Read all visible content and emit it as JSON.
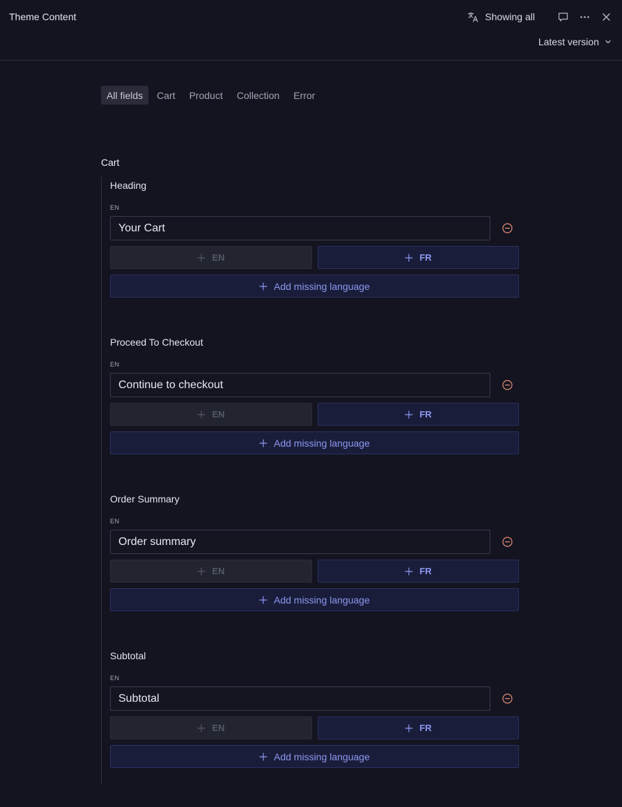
{
  "header": {
    "title": "Theme Content",
    "showing_label": "Showing all",
    "version_label": "Latest version",
    "icons": [
      "translate-icon",
      "comment-icon",
      "more-icon",
      "close-icon",
      "chevron-down-icon"
    ]
  },
  "tabs": [
    {
      "label": "All fields",
      "active": true
    },
    {
      "label": "Cart",
      "active": false
    },
    {
      "label": "Product",
      "active": false
    },
    {
      "label": "Collection",
      "active": false
    },
    {
      "label": "Error",
      "active": false
    }
  ],
  "section": {
    "title": "Cart",
    "fields": [
      {
        "label": "Heading",
        "lang": "EN",
        "value": "Your Cart",
        "en_button": "EN",
        "fr_button": "FR",
        "add_missing": "Add missing language"
      },
      {
        "label": "Proceed To Checkout",
        "lang": "EN",
        "value": "Continue to checkout",
        "en_button": "EN",
        "fr_button": "FR",
        "add_missing": "Add missing language"
      },
      {
        "label": "Order Summary",
        "lang": "EN",
        "value": "Order summary",
        "en_button": "EN",
        "fr_button": "FR",
        "add_missing": "Add missing language"
      },
      {
        "label": "Subtotal",
        "lang": "EN",
        "value": "Subtotal",
        "en_button": "EN",
        "fr_button": "FR",
        "add_missing": "Add missing language"
      }
    ]
  },
  "colors": {
    "background": "#13141f",
    "accent": "#8c98f0",
    "remove_icon": "#e8907a"
  }
}
